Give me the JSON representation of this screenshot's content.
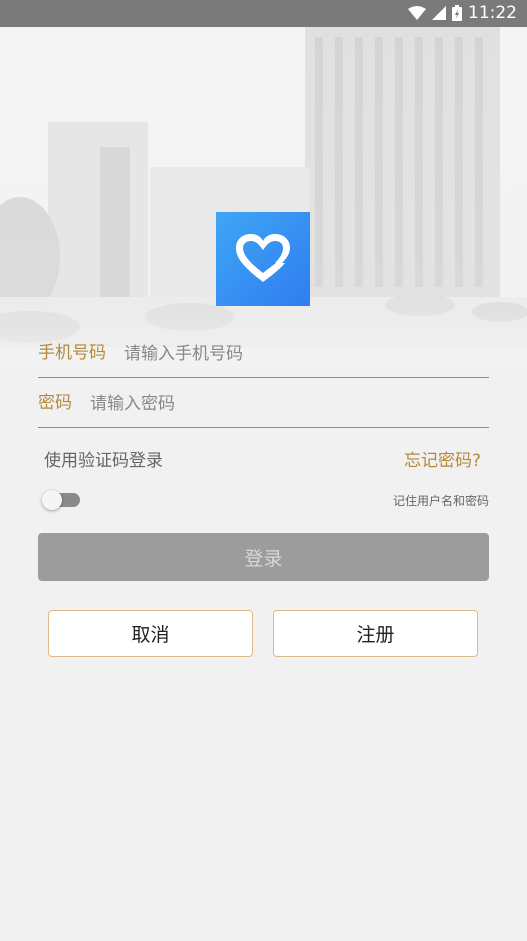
{
  "status_bar": {
    "time": "11:22",
    "icons": [
      "wifi-icon",
      "signal-icon",
      "battery-icon"
    ]
  },
  "logo": {
    "icon": "heart-icon",
    "accent": "#3a8ff2"
  },
  "form": {
    "phone": {
      "label": "手机号码",
      "placeholder": "请输入手机号码"
    },
    "password": {
      "label": "密码",
      "placeholder": "请输入密码"
    },
    "sms_login_link": "使用验证码登录",
    "forgot_link": "忘记密码?",
    "remember_label": "记住用户名和密码",
    "remember_on": false,
    "login_label": "登录",
    "cancel_label": "取消",
    "register_label": "注册"
  },
  "colors": {
    "label_gold": "#b38a3c",
    "button_border": "#e0b98a",
    "login_disabled": "#9c9c9c"
  }
}
